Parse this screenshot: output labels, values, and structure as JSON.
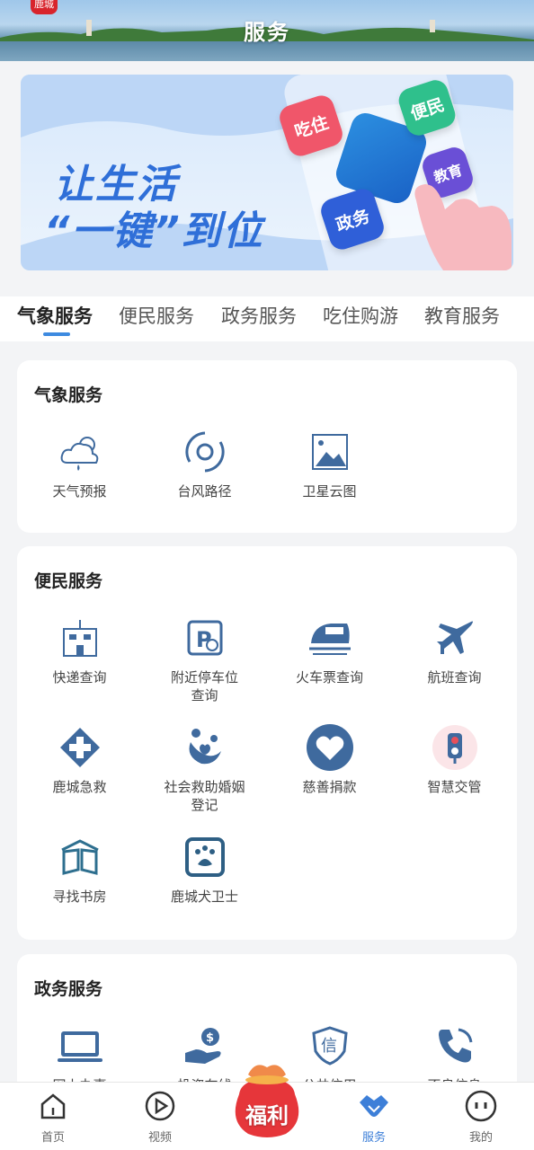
{
  "header": {
    "title": "服务",
    "logo_text": "鹿城"
  },
  "banner": {
    "line1": "让生活",
    "line2": "“一键”到位",
    "tags": [
      "吃住",
      "便民",
      "教育",
      "政务"
    ]
  },
  "tabs": [
    "气象服务",
    "便民服务",
    "政务服务",
    "吃住购游",
    "教育服务"
  ],
  "sections": {
    "weather": {
      "title": "气象服务",
      "items": [
        {
          "label": "天气预报",
          "icon": "weather-cloud-icon"
        },
        {
          "label": "台风路径",
          "icon": "typhoon-icon"
        },
        {
          "label": "卫星云图",
          "icon": "satellite-image-icon"
        }
      ]
    },
    "convenience": {
      "title": "便民服务",
      "items": [
        {
          "label": "快递查询",
          "icon": "building-icon"
        },
        {
          "label": "附近停车位查询",
          "icon": "parking-icon"
        },
        {
          "label": "火车票查询",
          "icon": "train-icon"
        },
        {
          "label": "航班查询",
          "icon": "plane-icon"
        },
        {
          "label": "鹿城急救",
          "icon": "medical-cross-icon"
        },
        {
          "label": "社会救助婚姻登记",
          "icon": "family-icon"
        },
        {
          "label": "慈善捐款",
          "icon": "heart-icon"
        },
        {
          "label": "智慧交管",
          "icon": "traffic-light-icon"
        },
        {
          "label": "寻找书房",
          "icon": "book-icon"
        },
        {
          "label": "鹿城犬卫士",
          "icon": "paw-icon"
        }
      ]
    },
    "government": {
      "title": "政务服务",
      "items": [
        {
          "label": "网上办事",
          "icon": "laptop-icon"
        },
        {
          "label": "投资在线",
          "icon": "investment-icon"
        },
        {
          "label": "公共信用",
          "icon": "credit-shield-icon"
        },
        {
          "label": "不良信息",
          "icon": "phone-icon"
        }
      ]
    }
  },
  "bottom_nav": {
    "home": "首页",
    "video": "视频",
    "fuli": "福利",
    "service": "服务",
    "mine": "我的",
    "active": "服务"
  },
  "colors": {
    "accent": "#3d7fd8",
    "icon_blue": "#3f6a9e",
    "text_dark": "#222222"
  }
}
